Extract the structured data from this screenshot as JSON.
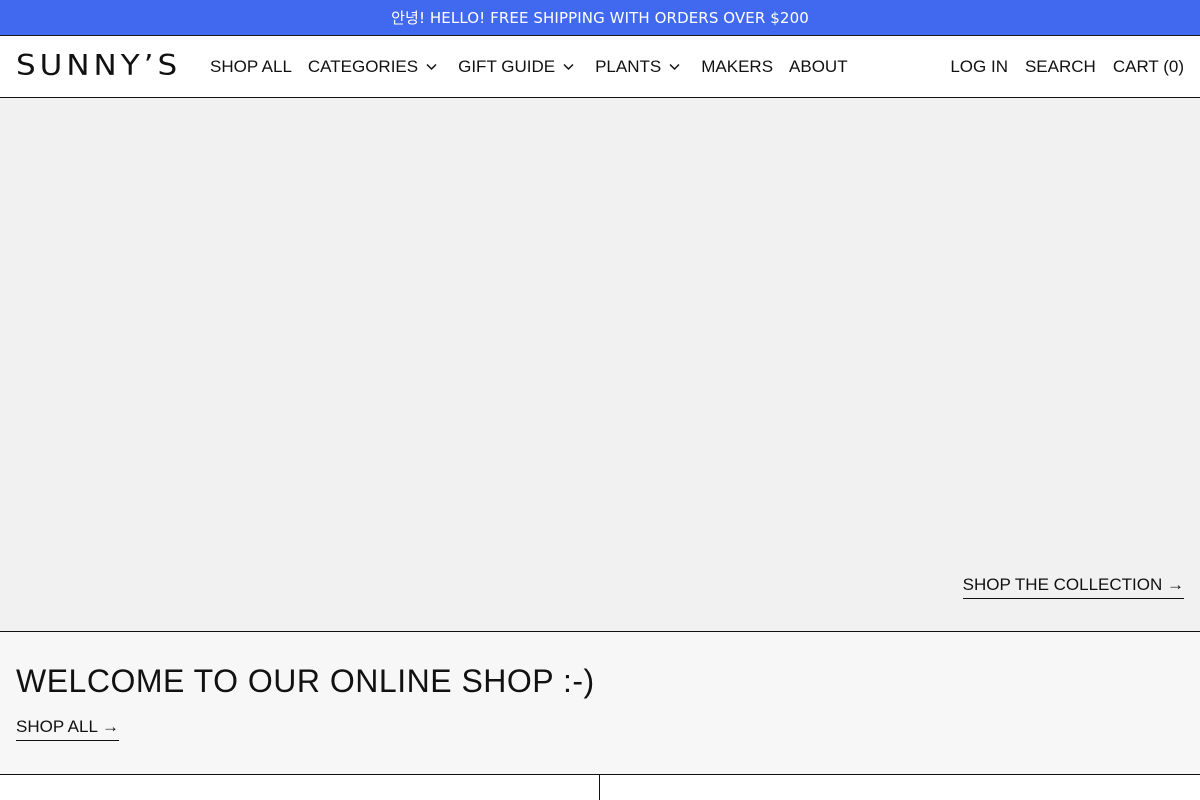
{
  "announcement": {
    "text": "안녕! HELLO! FREE SHIPPING WITH ORDERS OVER $200"
  },
  "header": {
    "logo": "SUNNY’S",
    "nav": [
      {
        "label": "SHOP ALL",
        "dropdown": false
      },
      {
        "label": "CATEGORIES",
        "dropdown": true,
        "icon": "chevron-down-icon"
      },
      {
        "label": "GIFT GUIDE",
        "dropdown": true,
        "icon": "chevron-down-icon"
      },
      {
        "label": "PLANTS",
        "dropdown": true,
        "icon": "chevron-down-icon"
      },
      {
        "label": "MAKERS",
        "dropdown": false
      },
      {
        "label": "ABOUT",
        "dropdown": false
      }
    ],
    "account": {
      "login": "LOG IN",
      "search": "SEARCH",
      "cart": "CART (0)"
    }
  },
  "hero": {
    "cta": "SHOP THE COLLECTION →"
  },
  "welcome": {
    "title": "WELCOME TO OUR ONLINE SHOP :-)",
    "cta": "SHOP ALL →"
  },
  "colors": {
    "announcement_bg": "#4169ef",
    "hero_bg": "#f1f1f1",
    "welcome_bg": "#f7f7f7",
    "text": "#111111"
  }
}
